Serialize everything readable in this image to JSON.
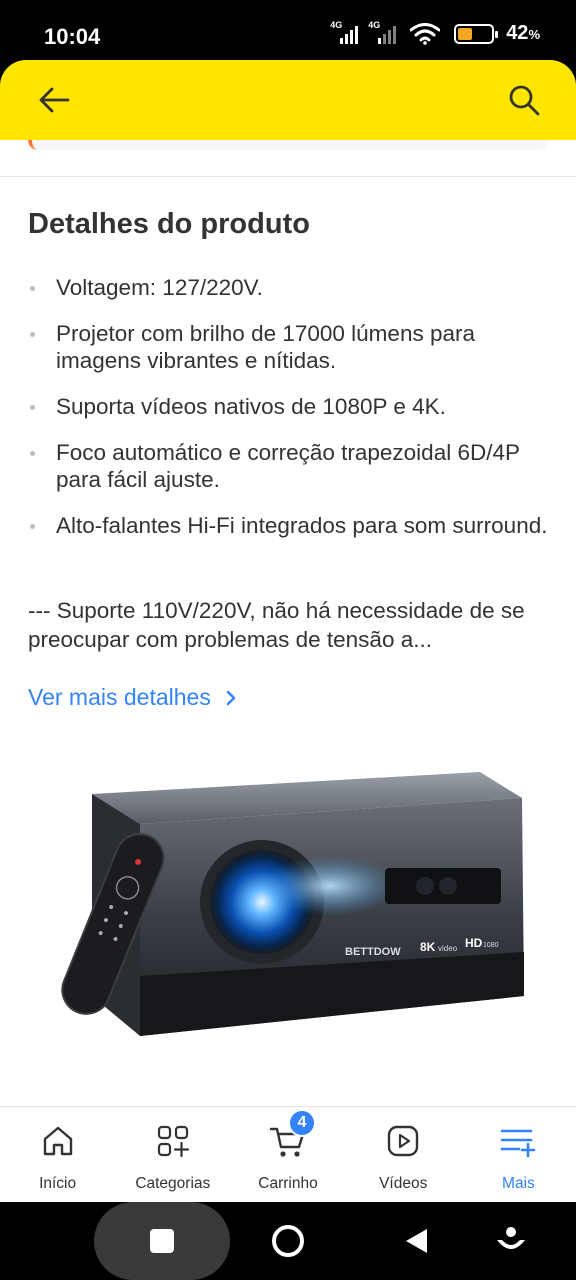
{
  "status_bar": {
    "time": "10:04",
    "network_1": "4G",
    "network_2": "4G",
    "battery_percent": "42",
    "battery_unit": "%",
    "battery_level": 0.42,
    "battery_color": "#f5a623"
  },
  "header": {
    "background": "#ffe600",
    "back_icon": "arrow-left-icon",
    "search_icon": "search-icon"
  },
  "details": {
    "title": "Detalhes do produto",
    "bullets": [
      "Voltagem: 127/220V.",
      "Projetor com brilho de 17000 lúmens para imagens vibrantes e nítidas.",
      "Suporta vídeos nativos de 1080P e 4K.",
      "Foco automático e correção trapezoidal 6D/4P para fácil ajuste.",
      "Alto-falantes Hi-Fi integrados para som surround."
    ],
    "description": "--- Suporte 110V/220V, não há necessidade de se preocupar com problemas de tensão a...",
    "more_link": "Ver mais detalhes",
    "link_color": "#3483fa"
  },
  "product_image": {
    "brand": "BETTDOW",
    "badge_8k": "8K",
    "badge_8k_sub": "video",
    "badge_hd": "HD",
    "badge_hd_sub": "1080"
  },
  "bottom_nav": {
    "items": [
      {
        "label": "Início",
        "icon": "home-icon"
      },
      {
        "label": "Categorias",
        "icon": "categories-icon"
      },
      {
        "label": "Carrinho",
        "icon": "cart-icon",
        "badge": "4"
      },
      {
        "label": "Vídeos",
        "icon": "video-icon"
      },
      {
        "label": "Mais",
        "icon": "menu-plus-icon",
        "active": true
      }
    ],
    "active_color": "#3483fa"
  },
  "system_nav": {
    "buttons": [
      "recents-icon",
      "home-circle-icon",
      "back-triangle-icon",
      "assistant-icon"
    ]
  }
}
